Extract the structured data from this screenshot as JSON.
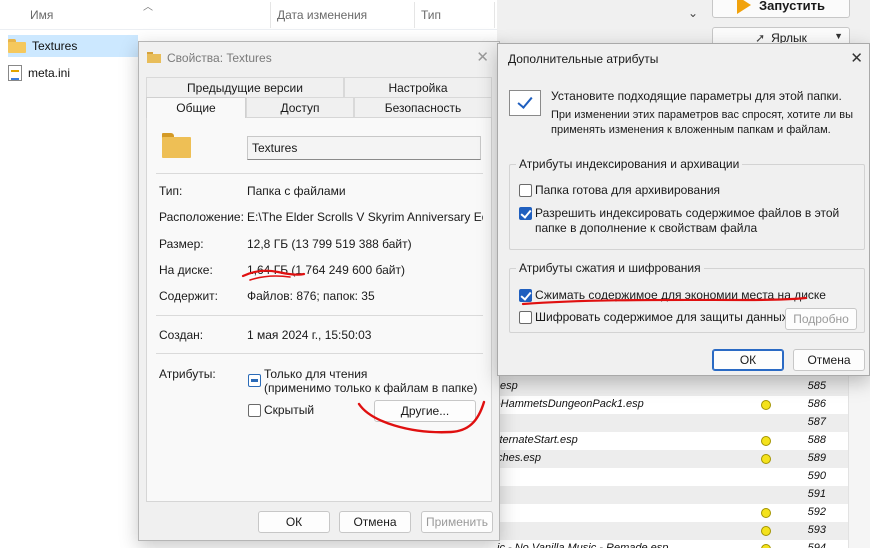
{
  "explorer": {
    "columns": {
      "name": "Имя",
      "date": "Дата изменения",
      "type": "Тип"
    },
    "files": [
      {
        "name": "Textures",
        "icon": "folder-icon"
      },
      {
        "name": "meta.ini",
        "icon": "ini-file-icon"
      }
    ]
  },
  "launcher": {
    "run_label": "Запустить",
    "shortcut_label": "Ярлык"
  },
  "mod_list": [
    {
      "name": ".esp",
      "num": "585",
      "dot": false
    },
    {
      "name": "-HammetsDungeonPack1.esp",
      "num": "586",
      "dot": true
    },
    {
      "name": "",
      "num": "587",
      "dot": false
    },
    {
      "name": "lternateStart.esp",
      "num": "588",
      "dot": true
    },
    {
      "name": "ches.esp",
      "num": "589",
      "dot": true
    },
    {
      "name": "",
      "num": "590",
      "dot": false
    },
    {
      "name": "",
      "num": "591",
      "dot": false
    },
    {
      "name": "",
      "num": "592",
      "dot": true
    },
    {
      "name": "",
      "num": "593",
      "dot": true
    },
    {
      "name": "ic - No Vanilla Music - Remade.esp",
      "num": "594",
      "dot": true
    }
  ],
  "props": {
    "title": "Свойства: Textures",
    "tabs_row1": [
      "Предыдущие версии",
      "Настройка"
    ],
    "tabs_row2": [
      "Общие",
      "Доступ",
      "Безопасность"
    ],
    "folder_name": "Textures",
    "fields": {
      "type_label": "Тип:",
      "type_value": "Папка с файлами",
      "location_label": "Расположение:",
      "location_value": "E:\\The Elder Scrolls V Skyrim Anniversary Edition\\",
      "size_label": "Размер:",
      "size_value": "12,8 ГБ (13 799 519 388 байт)",
      "disk_label": "На диске:",
      "disk_value": "1,64 ГБ (1 764 249 600 байт)",
      "contains_label": "Содержит:",
      "contains_value": "Файлов: 876; папок: 35",
      "created_label": "Создан:",
      "created_value": "1 мая 2024 г., 15:50:03",
      "attributes_label": "Атрибуты:"
    },
    "readonly_line1": "Только для чтения",
    "readonly_line2": "(применимо только к файлам в папке)",
    "hidden_label": "Скрытый",
    "other_button": "Другие...",
    "ok": "ОК",
    "cancel": "Отмена",
    "apply": "Применить"
  },
  "advanced": {
    "title": "Дополнительные атрибуты",
    "intro": "Установите подходящие параметры для этой папки.",
    "intro_detail": "При изменении этих параметров вас спросят, хотите ли вы применять изменения к вложенным папкам и файлам.",
    "group_index": "Атрибуты индексирования и архивации",
    "opt_archive": "Папка готова для архивирования",
    "opt_index": "Разрешить индексировать содержимое файлов в этой папке в дополнение к свойствам файла",
    "group_compress": "Атрибуты сжатия и шифрования",
    "opt_compress": "Сжимать содержимое для экономии места на диске",
    "opt_encrypt": "Шифровать содержимое для защиты данных",
    "details_button": "Подробно",
    "ok": "ОК",
    "cancel": "Отмена",
    "states": {
      "archive": false,
      "index": true,
      "compress": true,
      "encrypt": false
    }
  },
  "colors": {
    "accent": "#1f5fbf",
    "annotation": "#e01010",
    "folder": "#eebf55"
  }
}
